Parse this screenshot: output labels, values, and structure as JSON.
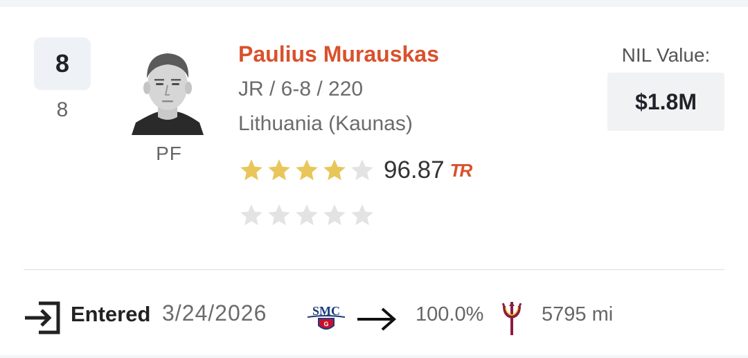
{
  "player": {
    "rank": "8",
    "rank_sub": "8",
    "position": "PF",
    "name": "Paulius Murauskas",
    "meta": "JR / 6-8 / 220",
    "hometown": "Lithuania (Kaunas)",
    "rating": "96.87",
    "rating_logo": "TR",
    "stars_filled": 4,
    "stars_total": 5,
    "secondary_stars_filled": 0
  },
  "nil": {
    "label": "NIL Value:",
    "value": "$1.8M"
  },
  "transfer": {
    "status": "Entered",
    "date": "3/24/2026",
    "from_school_logo_text": "SMC",
    "percent": "100.0%",
    "distance": "5795 mi"
  },
  "colors": {
    "accent": "#d9512c",
    "star_gold": "#e8c65a",
    "star_empty": "#e3e3e3",
    "smc_navy": "#1d3b7a",
    "smc_red": "#c8102e",
    "asu_maroon": "#8c1d40",
    "asu_gold": "#ffc627"
  },
  "icons": {
    "entered": "enter-icon",
    "arrow": "arrow-right-icon",
    "star": "star-icon"
  }
}
